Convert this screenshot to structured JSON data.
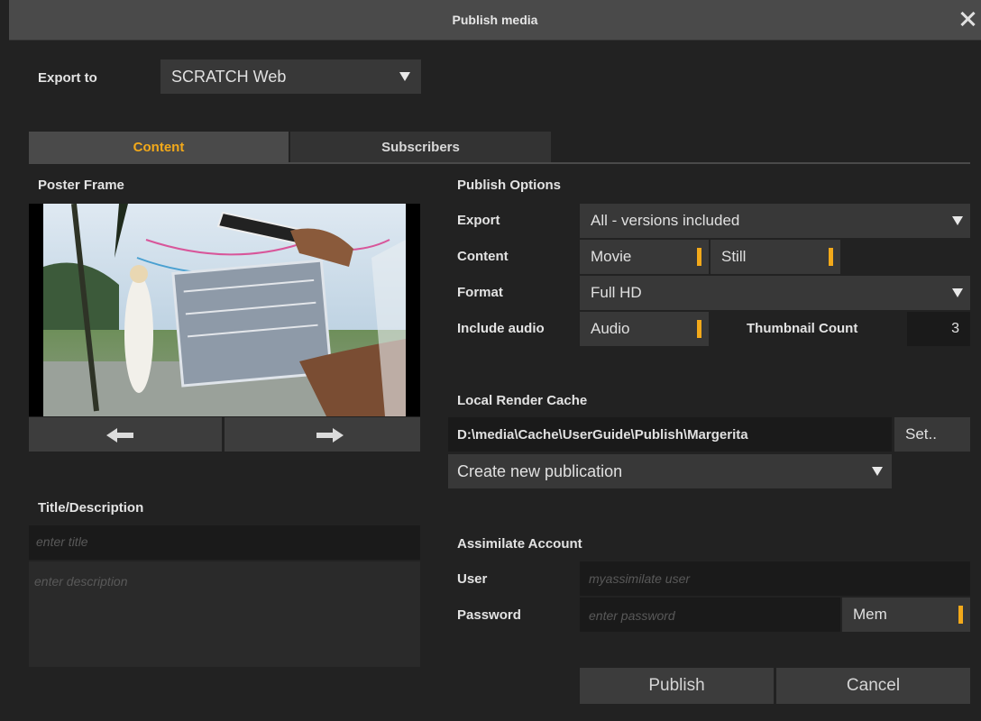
{
  "window": {
    "title": "Publish media"
  },
  "export_to": {
    "label": "Export to",
    "value": "SCRATCH Web"
  },
  "tabs": [
    {
      "label": "Content",
      "active": true
    },
    {
      "label": "Subscribers",
      "active": false
    }
  ],
  "poster": {
    "label": "Poster Frame"
  },
  "title_desc": {
    "label": "Title/Description",
    "title_placeholder": "enter title",
    "desc_placeholder": "enter description"
  },
  "publish_options": {
    "label": "Publish Options",
    "export_label": "Export",
    "export_value": "All - versions included",
    "content_label": "Content",
    "movie": "Movie",
    "still": "Still",
    "format_label": "Format",
    "format_value": "Full HD",
    "audio_label": "Include audio",
    "audio": "Audio",
    "thumb_label": "Thumbnail Count",
    "thumb_value": "3"
  },
  "cache": {
    "label": "Local Render Cache",
    "path": "D:\\media\\Cache\\UserGuide\\Publish\\Margerita",
    "set": "Set..",
    "publication": "Create new publication"
  },
  "account": {
    "label": "Assimilate Account",
    "user_label": "User",
    "user_placeholder": "myassimilate user",
    "pass_label": "Password",
    "pass_placeholder": "enter password",
    "mem": "Mem"
  },
  "actions": {
    "publish": "Publish",
    "cancel": "Cancel"
  },
  "colors": {
    "accent": "#f2a91a",
    "background": "#222222",
    "field": "#383838"
  }
}
